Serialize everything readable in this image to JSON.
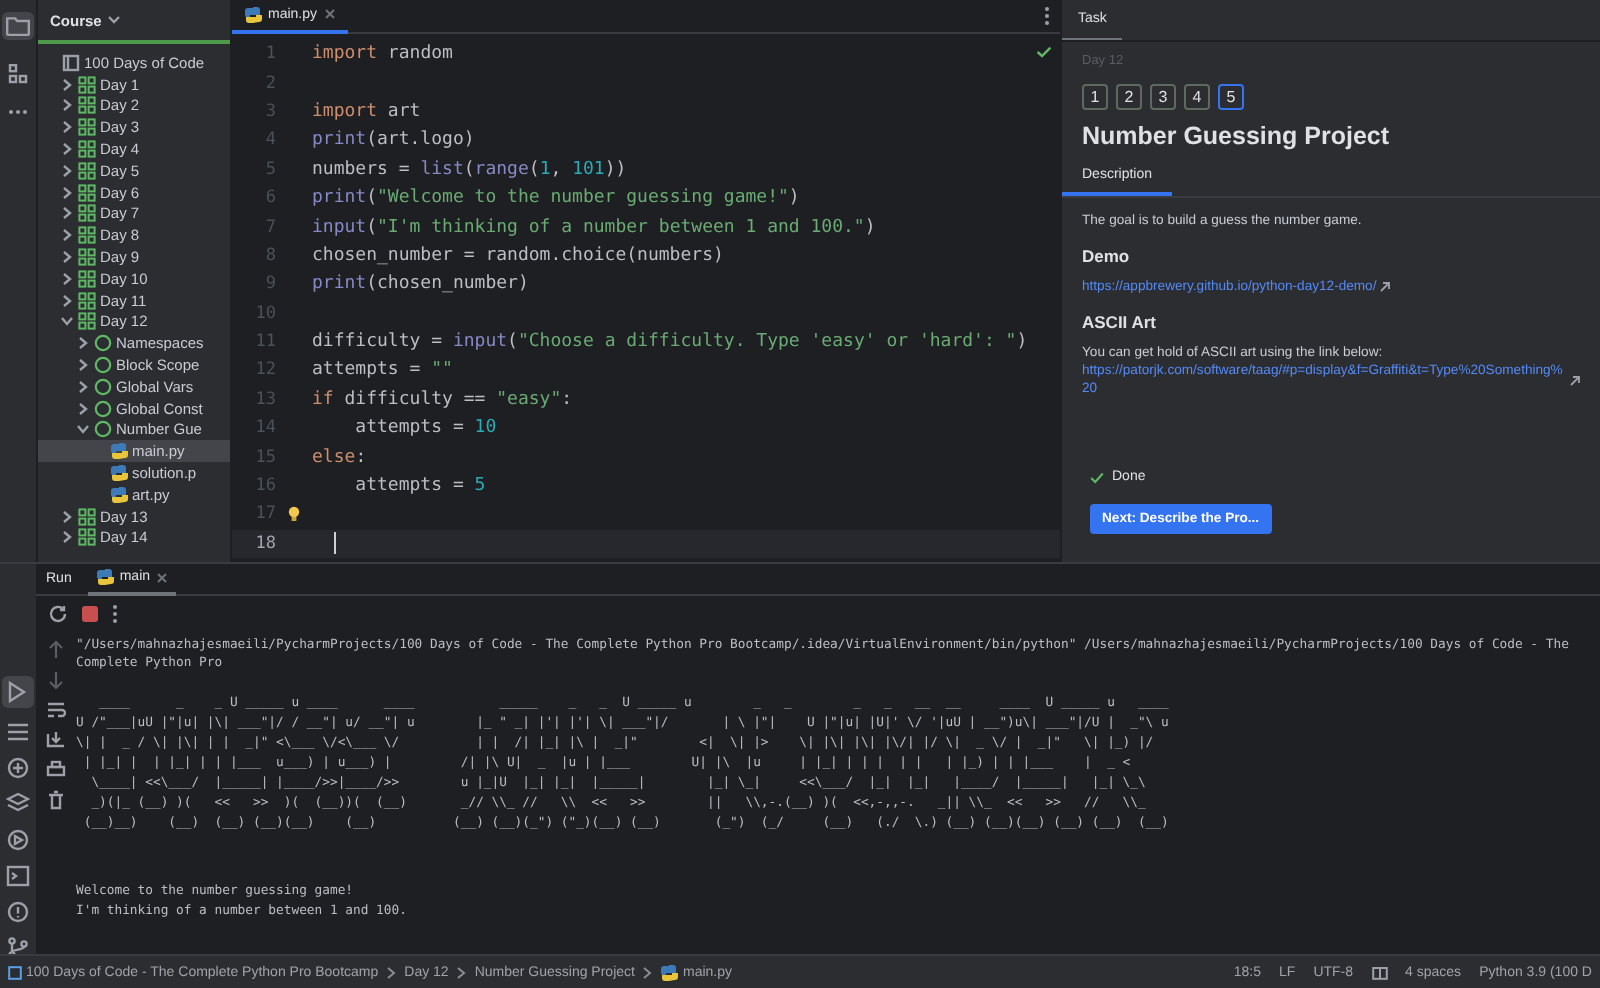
{
  "project": {
    "selector": "Course",
    "tree": [
      {
        "kind": "course",
        "label": "100 Days of Code",
        "selected": false,
        "children": [
          {
            "kind": "lesson",
            "label": "Day 1",
            "expanded": false,
            "selected": false
          },
          {
            "kind": "lesson",
            "label": "Day 2",
            "expanded": false,
            "selected": false
          },
          {
            "kind": "lesson",
            "label": "Day 3",
            "expanded": false,
            "selected": false
          },
          {
            "kind": "lesson",
            "label": "Day 4",
            "expanded": false,
            "selected": false
          },
          {
            "kind": "lesson",
            "label": "Day 5",
            "expanded": false,
            "selected": false
          },
          {
            "kind": "lesson",
            "label": "Day 6",
            "expanded": false,
            "selected": false
          },
          {
            "kind": "lesson",
            "label": "Day 7",
            "expanded": false,
            "selected": false
          },
          {
            "kind": "lesson",
            "label": "Day 8",
            "expanded": false,
            "selected": false
          },
          {
            "kind": "lesson",
            "label": "Day 9",
            "expanded": false,
            "selected": false
          },
          {
            "kind": "lesson",
            "label": "Day 10",
            "expanded": false,
            "selected": false
          },
          {
            "kind": "lesson",
            "label": "Day 11",
            "expanded": false,
            "selected": false
          },
          {
            "kind": "lesson",
            "label": "Day 12",
            "expanded": true,
            "selected": false,
            "children": [
              {
                "kind": "task",
                "label": "Namespaces",
                "expanded": false,
                "selected": false
              },
              {
                "kind": "task",
                "label": "Block Scope",
                "expanded": false,
                "selected": false
              },
              {
                "kind": "task",
                "label": "Global Vars",
                "expanded": false,
                "selected": false
              },
              {
                "kind": "task",
                "label": "Global Const",
                "expanded": false,
                "selected": false
              },
              {
                "kind": "task",
                "label": "Number Gue",
                "expanded": true,
                "selected": false,
                "children": [
                  {
                    "kind": "file",
                    "label": "main.py",
                    "selected": true
                  },
                  {
                    "kind": "file",
                    "label": "solution.p",
                    "selected": false
                  },
                  {
                    "kind": "file",
                    "label": "art.py",
                    "selected": false
                  }
                ]
              }
            ]
          },
          {
            "kind": "lesson",
            "label": "Day 13",
            "expanded": false,
            "selected": false
          },
          {
            "kind": "lesson",
            "label": "Day 14",
            "expanded": false,
            "selected": false
          }
        ]
      }
    ]
  },
  "editor": {
    "tabs": [
      {
        "label": "main.py",
        "selected": true
      }
    ],
    "lines": [
      {
        "number": "1",
        "current": false,
        "hint": false,
        "tokens": [
          {
            "kind": "keyword",
            "text": "import"
          },
          {
            "kind": "plain",
            "text": " random"
          }
        ]
      },
      {
        "number": "2",
        "current": false,
        "hint": false
      },
      {
        "number": "3",
        "current": false,
        "hint": false,
        "tokens": [
          {
            "kind": "keyword",
            "text": "import"
          },
          {
            "kind": "plain",
            "text": " art"
          }
        ]
      },
      {
        "number": "4",
        "current": false,
        "hint": false,
        "tokens": [
          {
            "kind": "builtin",
            "text": "print"
          },
          {
            "kind": "plain",
            "text": "(art.logo)"
          }
        ]
      },
      {
        "number": "5",
        "current": false,
        "hint": false,
        "tokens": [
          {
            "kind": "plain",
            "text": "numbers = "
          },
          {
            "kind": "builtin",
            "text": "list"
          },
          {
            "kind": "plain",
            "text": "("
          },
          {
            "kind": "builtin",
            "text": "range"
          },
          {
            "kind": "plain",
            "text": "("
          },
          {
            "kind": "number",
            "text": "1"
          },
          {
            "kind": "plain",
            "text": ", "
          },
          {
            "kind": "number",
            "text": "101"
          },
          {
            "kind": "plain",
            "text": "))"
          }
        ]
      },
      {
        "number": "6",
        "current": false,
        "hint": false,
        "tokens": [
          {
            "kind": "builtin",
            "text": "print"
          },
          {
            "kind": "plain",
            "text": "("
          },
          {
            "kind": "string",
            "text": "\"Welcome to the number guessing game!\""
          },
          {
            "kind": "plain",
            "text": ")"
          }
        ]
      },
      {
        "number": "7",
        "current": false,
        "hint": false,
        "tokens": [
          {
            "kind": "builtin",
            "text": "input"
          },
          {
            "kind": "plain",
            "text": "("
          },
          {
            "kind": "string",
            "text": "\"I'm thinking of a number between 1 and 100.\""
          },
          {
            "kind": "plain",
            "text": ")"
          }
        ]
      },
      {
        "number": "8",
        "current": false,
        "hint": false,
        "tokens": [
          {
            "kind": "plain",
            "text": "chosen_number = random.choice(numbers)"
          }
        ]
      },
      {
        "number": "9",
        "current": false,
        "hint": false,
        "tokens": [
          {
            "kind": "builtin",
            "text": "print"
          },
          {
            "kind": "plain",
            "text": "(chosen_number)"
          }
        ]
      },
      {
        "number": "10",
        "current": false,
        "hint": false
      },
      {
        "number": "11",
        "current": false,
        "hint": false,
        "tokens": [
          {
            "kind": "plain",
            "text": "difficulty = "
          },
          {
            "kind": "builtin",
            "text": "input"
          },
          {
            "kind": "plain",
            "text": "("
          },
          {
            "kind": "string",
            "text": "\"Choose a difficulty. Type 'easy' or 'hard': \""
          },
          {
            "kind": "plain",
            "text": ")"
          }
        ]
      },
      {
        "number": "12",
        "current": false,
        "hint": false,
        "tokens": [
          {
            "kind": "plain",
            "text": "attempts = "
          },
          {
            "kind": "string",
            "text": "\"\""
          }
        ]
      },
      {
        "number": "13",
        "current": false,
        "hint": false,
        "tokens": [
          {
            "kind": "keyword",
            "text": "if"
          },
          {
            "kind": "plain",
            "text": " difficulty == "
          },
          {
            "kind": "string",
            "text": "\"easy\""
          },
          {
            "kind": "plain",
            "text": ":"
          }
        ]
      },
      {
        "number": "14",
        "current": false,
        "hint": false,
        "tokens": [
          {
            "kind": "plain",
            "text": "    attempts = "
          },
          {
            "kind": "number",
            "text": "10"
          }
        ]
      },
      {
        "number": "15",
        "current": false,
        "hint": false,
        "tokens": [
          {
            "kind": "keyword",
            "text": "else"
          },
          {
            "kind": "plain",
            "text": ":"
          }
        ]
      },
      {
        "number": "16",
        "current": false,
        "hint": false,
        "tokens": [
          {
            "kind": "plain",
            "text": "    attempts = "
          },
          {
            "kind": "number",
            "text": "5"
          }
        ]
      },
      {
        "number": "17",
        "current": false,
        "hint": true
      },
      {
        "number": "18",
        "current": true,
        "hint": false
      }
    ]
  },
  "task": {
    "tab": "Task",
    "lesson": "Day 12",
    "steps": [
      {
        "label": "1",
        "selected": false
      },
      {
        "label": "2",
        "selected": false
      },
      {
        "label": "3",
        "selected": false
      },
      {
        "label": "4",
        "selected": false
      },
      {
        "label": "5",
        "selected": true
      }
    ],
    "title": "Number Guessing Project",
    "tabs": [
      {
        "label": "Description",
        "selected": true
      }
    ],
    "content": [
      {
        "kind": "paragraph",
        "text": "The goal is to build a guess the number game."
      },
      {
        "kind": "heading",
        "text": "Demo"
      },
      {
        "kind": "link",
        "text": "https://appbrewery.github.io/python-day12-demo/"
      },
      {
        "kind": "heading",
        "text": "ASCII Art"
      },
      {
        "kind": "paragraph",
        "text": "You can get hold of ASCII art using the link below:"
      },
      {
        "kind": "link",
        "text": "https://patorjk.com/software/taag/#p=display&f=Graffiti&t=Type%20Something%20"
      }
    ],
    "done": {
      "label": "Done",
      "checked": true
    },
    "next_button": "Next: Describe the Pro..."
  },
  "run": {
    "label": "Run",
    "tabs": [
      {
        "label": "main",
        "selected": true
      }
    ],
    "command": "\"/Users/mahnazhajesmaeili/PycharmProjects/100 Days of Code - The Complete Python Pro Bootcamp/.idea/VirtualEnvironment/bin/python\" /Users/mahnazhajesmaeili/PycharmProjects/100 Days of Code - The Complete Python Pro",
    "art": [
      "   ____      _    _ U _____ u ____      ____           _____    _   _  U _____ u        _   _        _   _   __  __     ____  U _____ u   ____",
      "U /\"___|uU |\"|u| |\\| ___\"|/ / __\"| u/ __\"| u        |_ \" _| |'| |'| \\| ___\"|/       | \\ |\"|    U |\"|u| |U|' \\/ '|uU | __\")u\\| ___\"|/U |  _\"\\ u",
      "\\| |  _ / \\| |\\| | |  _|\" <\\___ \\/<\\___ \\/          | |  /| |_| |\\ |  _|\"        <|  \\| |>    \\| |\\| |\\| |\\/| |/ \\|  _ \\/ |  _|\"   \\| |_) |/",
      " | |_| |  | |_| | | |___  u___) | u___) |         /| |\\ U|  _  |u | |___        U| |\\  |u     | |_| | | |  | |   | |_) | | |___    |  _ <",
      "  \\____| <<\\___/  |_____| |____/>>|____/>>        u |_|U  |_| |_|  |_____|        |_| \\_|     <<\\___/  |_|  |_|   |____/  |_____|   |_| \\_\\",
      "  _)(|_ (__) )(   <<   >>  )(  (__))(  (__)       _// \\\\_ //   \\\\  <<   >>        ||   \\\\,-.(__) )(  <<,-,,-.   _|| \\\\_  <<   >>   //   \\\\_",
      " (__)__)    (__)  (__) (__)(__)    (__)          (__) (__)(_\") (\"_)(__) (__)       (_\")  (_/     (__)   (./  \\.) (__) (__)(__) (__) (__)  (__)"
    ],
    "output": [
      "Welcome to the number guessing game!",
      "I'm thinking of a number between 1 and 100."
    ]
  },
  "status_bar": {
    "breadcrumbs": [
      {
        "kind": "course",
        "label": "100 Days of Code - The Complete Python Pro Bootcamp"
      },
      {
        "kind": "plain",
        "label": "Day 12"
      },
      {
        "kind": "plain",
        "label": "Number Guessing Project"
      },
      {
        "kind": "file",
        "label": "main.py"
      }
    ],
    "items": [
      {
        "kind": "text",
        "label": "18:5"
      },
      {
        "kind": "text",
        "label": "LF"
      },
      {
        "kind": "text",
        "label": "UTF-8"
      },
      {
        "kind": "icon"
      },
      {
        "kind": "text",
        "label": "4 spaces"
      },
      {
        "kind": "text",
        "label": "Python 3.9 (100 D"
      }
    ]
  }
}
